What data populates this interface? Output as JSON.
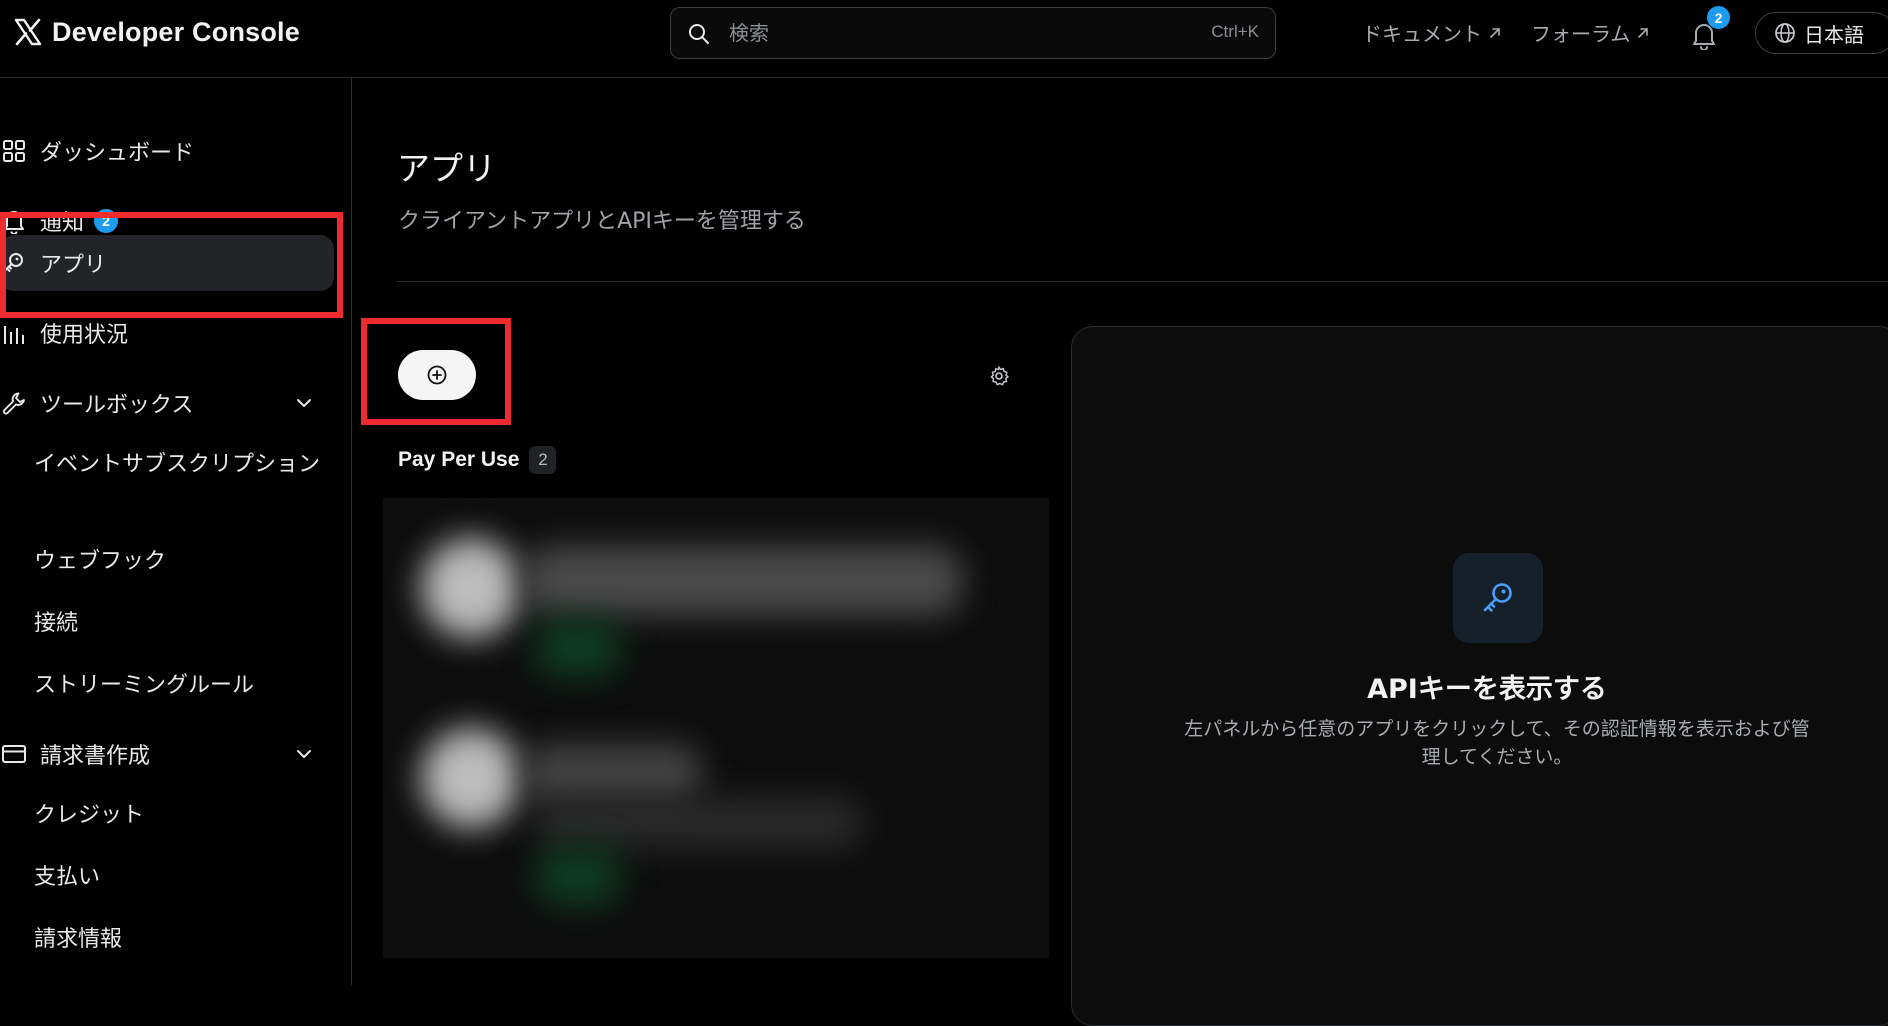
{
  "header": {
    "brand": "Developer Console",
    "search": {
      "placeholder": "検索",
      "shortcut": "Ctrl+K"
    },
    "links": [
      {
        "label": "ドキュメント"
      },
      {
        "label": "フォーラム"
      }
    ],
    "notification_count": "2",
    "language": "日本語"
  },
  "sidebar": {
    "items": [
      {
        "label": "ダッシュボード",
        "icon": "grid-icon"
      },
      {
        "label": "通知",
        "icon": "bell-icon",
        "badge": "2"
      },
      {
        "label": "アプリ",
        "icon": "key-icon",
        "active": true
      },
      {
        "label": "使用状況",
        "icon": "bar-chart-icon"
      },
      {
        "label": "ツールボックス",
        "icon": "wrench-icon",
        "expandable": true,
        "children": [
          {
            "label": "イベントサブスクリプション"
          },
          {
            "label": "ウェブフック"
          },
          {
            "label": "接続"
          },
          {
            "label": "ストリーミングルール"
          }
        ]
      },
      {
        "label": "請求書作成",
        "icon": "credit-card-icon",
        "expandable": true,
        "children": [
          {
            "label": "クレジット"
          },
          {
            "label": "支払い"
          },
          {
            "label": "請求情報"
          }
        ]
      }
    ]
  },
  "main": {
    "title": "アプリ",
    "subtitle": "クライアントアプリとAPIキーを管理する",
    "group": {
      "label": "Pay Per Use",
      "count": "2"
    }
  },
  "detail": {
    "title": "APIキーを表示する",
    "text": "左パネルから任意のアプリをクリックして、その認証情報を表示および管理してください。"
  },
  "colors": {
    "accent": "#1d9bf0",
    "highlight": "#ef2b2d",
    "background": "#000000"
  }
}
